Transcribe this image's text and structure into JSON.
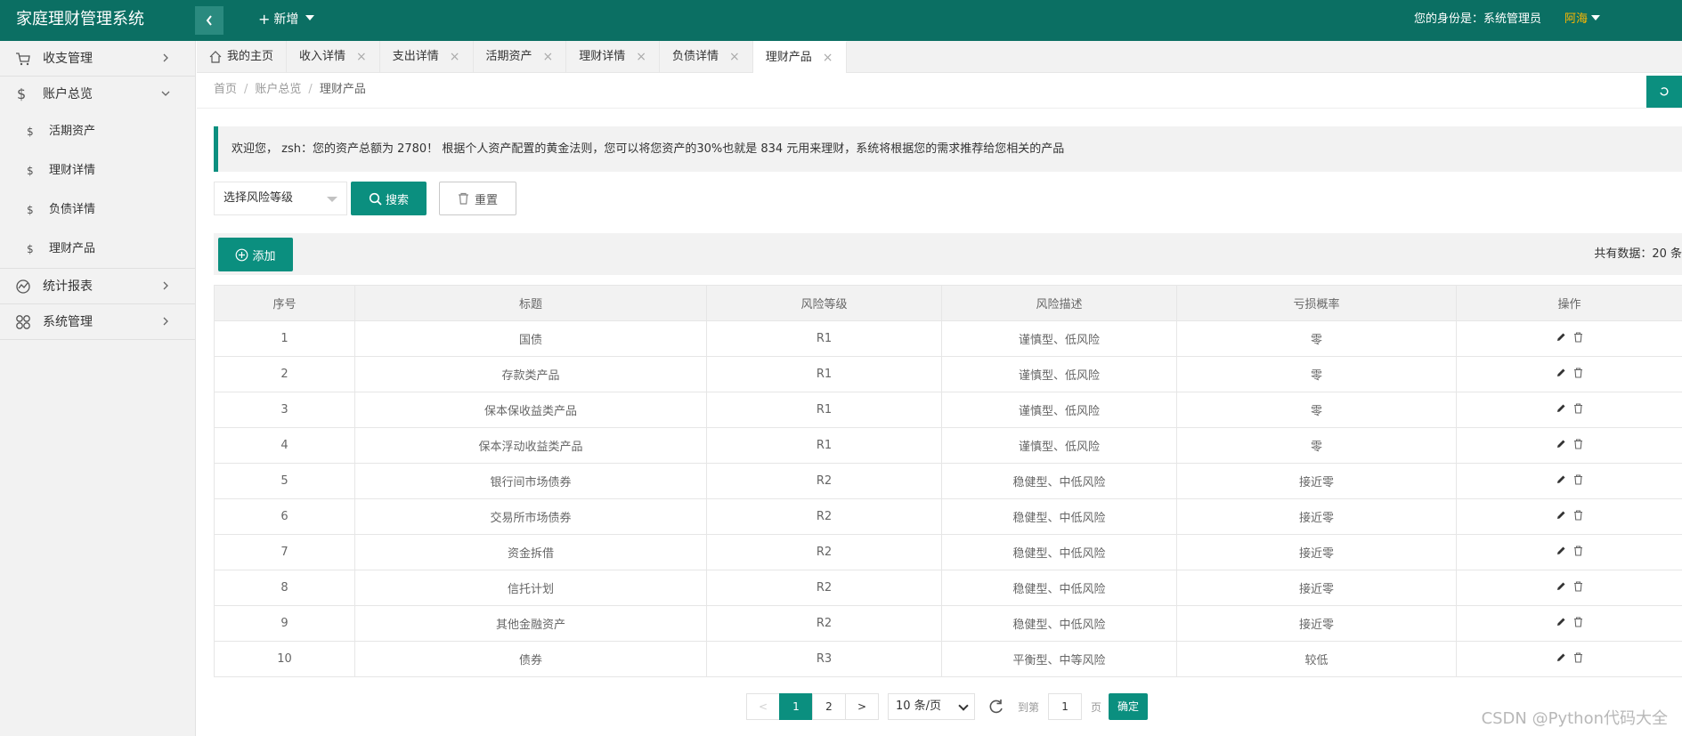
{
  "header": {
    "app_title": "家庭理财管理系统",
    "new_label": "新增",
    "identity_text": "您的身份是：系统管理员",
    "user_name": "阿海"
  },
  "sidebar": {
    "items": [
      {
        "label": "收支管理",
        "icon": "cart-icon"
      },
      {
        "label": "账户总览",
        "icon": "dollar-icon"
      },
      {
        "label": "统计报表",
        "icon": "chart-icon"
      },
      {
        "label": "系统管理",
        "icon": "cluster-icon"
      }
    ],
    "sub_items": [
      "活期资产",
      "理财详情",
      "负债详情",
      "理财产品"
    ],
    "sub_symbol": "$"
  },
  "tabs": [
    {
      "label": "我的主页",
      "closable": false
    },
    {
      "label": "收入详情",
      "closable": true
    },
    {
      "label": "支出详情",
      "closable": true
    },
    {
      "label": "活期资产",
      "closable": true
    },
    {
      "label": "理财详情",
      "closable": true
    },
    {
      "label": "负债详情",
      "closable": true
    },
    {
      "label": "理财产品",
      "closable": true,
      "active": true
    }
  ],
  "tab_close_symbol": "×",
  "breadcrumb": {
    "home": "首页",
    "level2": "账户总览",
    "current": "理财产品",
    "separator": "/"
  },
  "notice": "欢迎您， zsh：您的资产总额为 2780！ 根据个人资产配置的黄金法则，您可以将您资产的30%也就是 834 元用来理财，系统将根据您的需求推荐给您相关的产品",
  "search": {
    "select_placeholder": "选择风险等级",
    "search_label": "搜索",
    "reset_label": "重置"
  },
  "toolbar": {
    "add_label": "添加",
    "total_text": "共有数据：20 条"
  },
  "table": {
    "columns": [
      "序号",
      "标题",
      "风险等级",
      "风险描述",
      "亏损概率",
      "操作"
    ],
    "rows": [
      [
        "1",
        "国债",
        "R1",
        "谨慎型、低风险",
        "零"
      ],
      [
        "2",
        "存款类产品",
        "R1",
        "谨慎型、低风险",
        "零"
      ],
      [
        "3",
        "保本保收益类产品",
        "R1",
        "谨慎型、低风险",
        "零"
      ],
      [
        "4",
        "保本浮动收益类产品",
        "R1",
        "谨慎型、低风险",
        "零"
      ],
      [
        "5",
        "银行间市场债券",
        "R2",
        "稳健型、中低风险",
        "接近零"
      ],
      [
        "6",
        "交易所市场债券",
        "R2",
        "稳健型、中低风险",
        "接近零"
      ],
      [
        "7",
        "资金拆借",
        "R2",
        "稳健型、中低风险",
        "接近零"
      ],
      [
        "8",
        "信托计划",
        "R2",
        "稳健型、中低风险",
        "接近零"
      ],
      [
        "9",
        "其他金融资产",
        "R2",
        "稳健型、中低风险",
        "接近零"
      ],
      [
        "10",
        "债券",
        "R3",
        "平衡型、中等风险",
        "较低"
      ]
    ]
  },
  "pagination": {
    "prev": "<",
    "pages": [
      "1",
      "2"
    ],
    "current": "1",
    "next": ">",
    "page_size": "10 条/页",
    "goto_label": "到第",
    "goto_value": "1",
    "unit": "页",
    "confirm": "确定"
  },
  "watermark": "CSDN @Python代码大全",
  "colors": {
    "header_bg": "#0b6f63",
    "accent": "#0b8f7f",
    "user_name": "#ffb800"
  }
}
